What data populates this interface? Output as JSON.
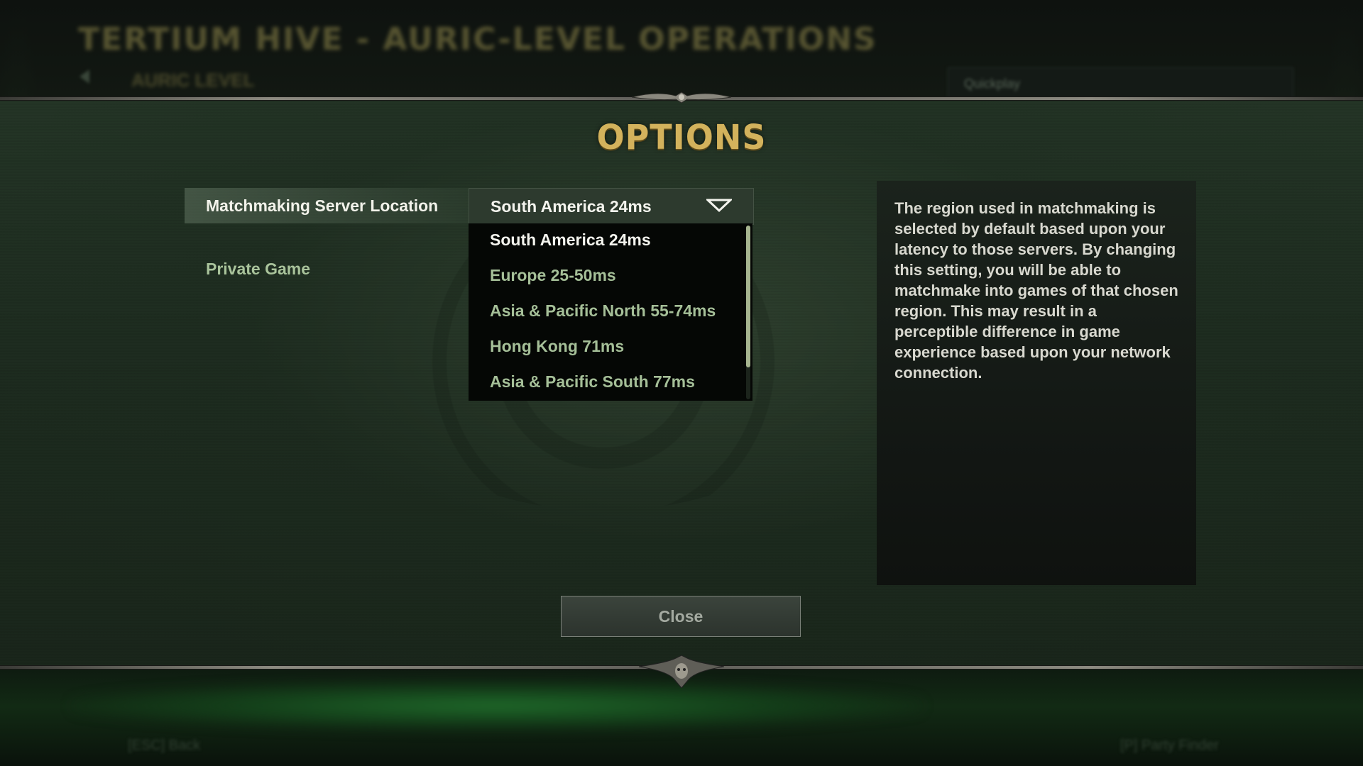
{
  "background": {
    "title": "TERTIUM HIVE - AURIC-LEVEL OPERATIONS",
    "subtitle": "AURIC LEVEL",
    "quickplay_label": "Quickplay",
    "footer_back": "[ESC] Back",
    "footer_party": "[P] Party Finder"
  },
  "modal": {
    "title": "OPTIONS",
    "settings": [
      {
        "label": "Matchmaking Server Location"
      },
      {
        "label": "Private Game"
      }
    ],
    "dropdown": {
      "selected": "South America 24ms",
      "options": [
        "South America 24ms",
        "Europe 25-50ms",
        "Asia & Pacific North 55-74ms",
        "Hong Kong 71ms",
        "Asia & Pacific South 77ms"
      ]
    },
    "description": "The region used in matchmaking is selected by default based upon your latency to those servers. By changing this setting, you will be able to matchmake into games of that chosen region. This may result in a perceptible difference in game experience based upon your network connection.",
    "close_label": "Close"
  },
  "colors": {
    "title_gold": "#d3b25c",
    "option_green": "#a5bf98",
    "selected_white": "#f4f4ee"
  }
}
